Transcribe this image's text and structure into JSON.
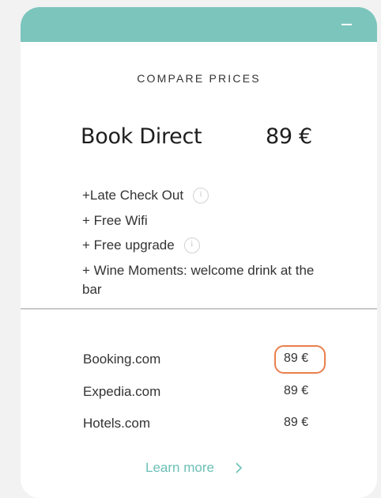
{
  "header": {
    "collapse_icon": "minus-icon",
    "color": "#7cc5bd"
  },
  "compare": {
    "title": "COMPARE PRICES"
  },
  "direct": {
    "label": "Book Direct",
    "price": "89 €"
  },
  "perks": [
    {
      "text": "+Late Check Out",
      "has_info": true
    },
    {
      "text": "+ Free Wifi",
      "has_info": false
    },
    {
      "text": "+ Free upgrade",
      "has_info": true
    },
    {
      "text": "+ Wine Moments: welcome drink at the bar",
      "has_info": false
    }
  ],
  "otas": [
    {
      "name": "Booking.com",
      "price": "89 €",
      "highlighted": true
    },
    {
      "name": "Expedia.com",
      "price": "89 €",
      "highlighted": false
    },
    {
      "name": "Hotels.com",
      "price": "89 €",
      "highlighted": false
    }
  ],
  "learn_more": {
    "label": "Learn more",
    "icon": "chevron-right-icon"
  },
  "colors": {
    "accent": "#7cc5bd",
    "link": "#6cc0b7",
    "highlight_border": "#e97f4c"
  }
}
